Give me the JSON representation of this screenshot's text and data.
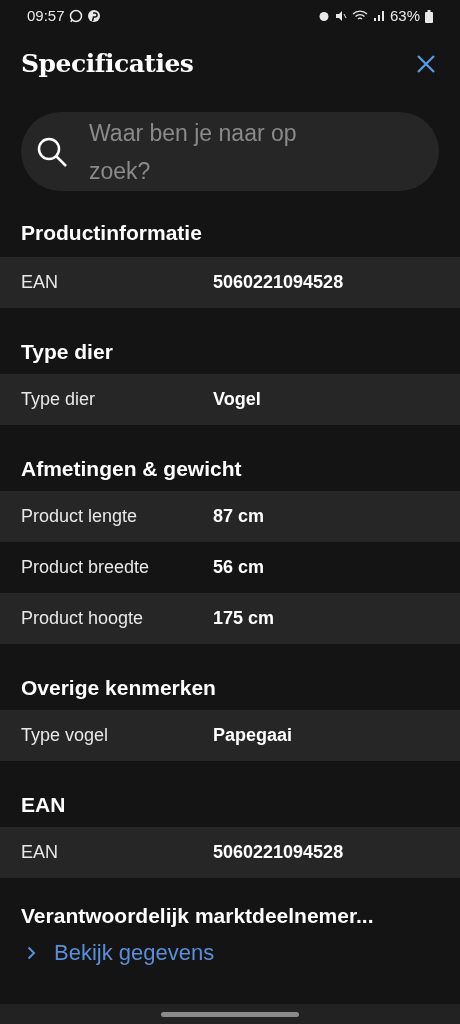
{
  "status_bar": {
    "time": "09:57",
    "battery": "63%"
  },
  "header": {
    "title": "Specificaties"
  },
  "search": {
    "placeholder": "Waar ben je naar op zoek?"
  },
  "sections": [
    {
      "title": "Productinformatie",
      "rows": [
        {
          "label": "EAN",
          "value": "5060221094528"
        }
      ]
    },
    {
      "title": "Type dier",
      "rows": [
        {
          "label": "Type dier",
          "value": "Vogel"
        }
      ]
    },
    {
      "title": "Afmetingen & gewicht",
      "rows": [
        {
          "label": "Product lengte",
          "value": "87 cm"
        },
        {
          "label": "Product breedte",
          "value": "56 cm"
        },
        {
          "label": "Product hoogte",
          "value": "175 cm"
        }
      ]
    },
    {
      "title": "Overige kenmerken",
      "rows": [
        {
          "label": "Type vogel",
          "value": "Papegaai"
        }
      ]
    },
    {
      "title": "EAN",
      "rows": [
        {
          "label": "EAN",
          "value": "5060221094528"
        }
      ]
    }
  ],
  "responsible": {
    "title": "Verantwoordelijk marktdeelnemer...",
    "link": "Bekijk gegevens"
  }
}
